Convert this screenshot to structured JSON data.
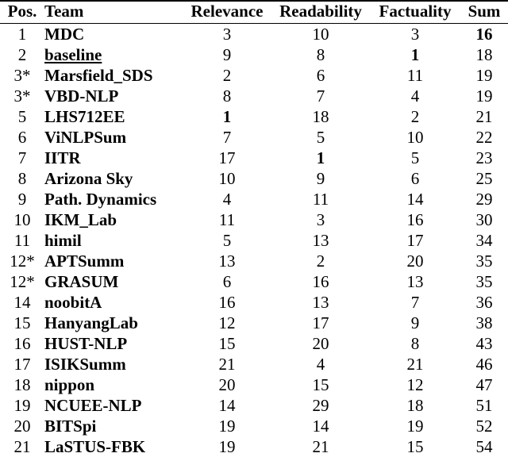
{
  "table": {
    "columns": [
      {
        "key": "pos",
        "label": "Pos."
      },
      {
        "key": "team",
        "label": "Team"
      },
      {
        "key": "relevance",
        "label": "Relevance"
      },
      {
        "key": "readability",
        "label": "Readability"
      },
      {
        "key": "factuality",
        "label": "Factuality"
      },
      {
        "key": "sum",
        "label": "Sum"
      }
    ],
    "rows": [
      {
        "pos": "1",
        "team": "MDC",
        "team_underline": false,
        "relevance": "3",
        "readability": "10",
        "factuality": "3",
        "sum": "16",
        "bold": {
          "relevance": false,
          "readability": false,
          "factuality": false,
          "sum": true
        }
      },
      {
        "pos": "2",
        "team": "baseline",
        "team_underline": true,
        "relevance": "9",
        "readability": "8",
        "factuality": "1",
        "sum": "18",
        "bold": {
          "relevance": false,
          "readability": false,
          "factuality": true,
          "sum": false
        }
      },
      {
        "pos": "3*",
        "team": "Marsfield_SDS",
        "team_underline": false,
        "relevance": "2",
        "readability": "6",
        "factuality": "11",
        "sum": "19",
        "bold": {
          "relevance": false,
          "readability": false,
          "factuality": false,
          "sum": false
        }
      },
      {
        "pos": "3*",
        "team": "VBD-NLP",
        "team_underline": false,
        "relevance": "8",
        "readability": "7",
        "factuality": "4",
        "sum": "19",
        "bold": {
          "relevance": false,
          "readability": false,
          "factuality": false,
          "sum": false
        }
      },
      {
        "pos": "5",
        "team": "LHS712EE",
        "team_underline": false,
        "relevance": "1",
        "readability": "18",
        "factuality": "2",
        "sum": "21",
        "bold": {
          "relevance": true,
          "readability": false,
          "factuality": false,
          "sum": false
        }
      },
      {
        "pos": "6",
        "team": "ViNLPSum",
        "team_underline": false,
        "relevance": "7",
        "readability": "5",
        "factuality": "10",
        "sum": "22",
        "bold": {
          "relevance": false,
          "readability": false,
          "factuality": false,
          "sum": false
        }
      },
      {
        "pos": "7",
        "team": "IITR",
        "team_underline": false,
        "relevance": "17",
        "readability": "1",
        "factuality": "5",
        "sum": "23",
        "bold": {
          "relevance": false,
          "readability": true,
          "factuality": false,
          "sum": false
        }
      },
      {
        "pos": "8",
        "team": "Arizona Sky",
        "team_underline": false,
        "relevance": "10",
        "readability": "9",
        "factuality": "6",
        "sum": "25",
        "bold": {
          "relevance": false,
          "readability": false,
          "factuality": false,
          "sum": false
        }
      },
      {
        "pos": "9",
        "team": "Path. Dynamics",
        "team_underline": false,
        "relevance": "4",
        "readability": "11",
        "factuality": "14",
        "sum": "29",
        "bold": {
          "relevance": false,
          "readability": false,
          "factuality": false,
          "sum": false
        }
      },
      {
        "pos": "10",
        "team": "IKM_Lab",
        "team_underline": false,
        "relevance": "11",
        "readability": "3",
        "factuality": "16",
        "sum": "30",
        "bold": {
          "relevance": false,
          "readability": false,
          "factuality": false,
          "sum": false
        }
      },
      {
        "pos": "11",
        "team": "himil",
        "team_underline": false,
        "relevance": "5",
        "readability": "13",
        "factuality": "17",
        "sum": "34",
        "bold": {
          "relevance": false,
          "readability": false,
          "factuality": false,
          "sum": false
        }
      },
      {
        "pos": "12*",
        "team": "APTSumm",
        "team_underline": false,
        "relevance": "13",
        "readability": "2",
        "factuality": "20",
        "sum": "35",
        "bold": {
          "relevance": false,
          "readability": false,
          "factuality": false,
          "sum": false
        }
      },
      {
        "pos": "12*",
        "team": "GRASUM",
        "team_underline": false,
        "relevance": "6",
        "readability": "16",
        "factuality": "13",
        "sum": "35",
        "bold": {
          "relevance": false,
          "readability": false,
          "factuality": false,
          "sum": false
        }
      },
      {
        "pos": "14",
        "team": "noobitA",
        "team_underline": false,
        "relevance": "16",
        "readability": "13",
        "factuality": "7",
        "sum": "36",
        "bold": {
          "relevance": false,
          "readability": false,
          "factuality": false,
          "sum": false
        }
      },
      {
        "pos": "15",
        "team": "HanyangLab",
        "team_underline": false,
        "relevance": "12",
        "readability": "17",
        "factuality": "9",
        "sum": "38",
        "bold": {
          "relevance": false,
          "readability": false,
          "factuality": false,
          "sum": false
        }
      },
      {
        "pos": "16",
        "team": "HUST-NLP",
        "team_underline": false,
        "relevance": "15",
        "readability": "20",
        "factuality": "8",
        "sum": "43",
        "bold": {
          "relevance": false,
          "readability": false,
          "factuality": false,
          "sum": false
        }
      },
      {
        "pos": "17",
        "team": "ISIKSumm",
        "team_underline": false,
        "relevance": "21",
        "readability": "4",
        "factuality": "21",
        "sum": "46",
        "bold": {
          "relevance": false,
          "readability": false,
          "factuality": false,
          "sum": false
        }
      },
      {
        "pos": "18",
        "team": "nippon",
        "team_underline": false,
        "relevance": "20",
        "readability": "15",
        "factuality": "12",
        "sum": "47",
        "bold": {
          "relevance": false,
          "readability": false,
          "factuality": false,
          "sum": false
        }
      },
      {
        "pos": "19",
        "team": "NCUEE-NLP",
        "team_underline": false,
        "relevance": "14",
        "readability": "29",
        "factuality": "18",
        "sum": "51",
        "bold": {
          "relevance": false,
          "readability": false,
          "factuality": false,
          "sum": false
        }
      },
      {
        "pos": "20",
        "team": "BITSpi",
        "team_underline": false,
        "relevance": "19",
        "readability": "14",
        "factuality": "19",
        "sum": "52",
        "bold": {
          "relevance": false,
          "readability": false,
          "factuality": false,
          "sum": false
        }
      },
      {
        "pos": "21",
        "team": "LaSTUS-FBK",
        "team_underline": false,
        "relevance": "19",
        "readability": "21",
        "factuality": "15",
        "sum": "54",
        "bold": {
          "relevance": false,
          "readability": false,
          "factuality": false,
          "sum": false
        }
      }
    ]
  }
}
